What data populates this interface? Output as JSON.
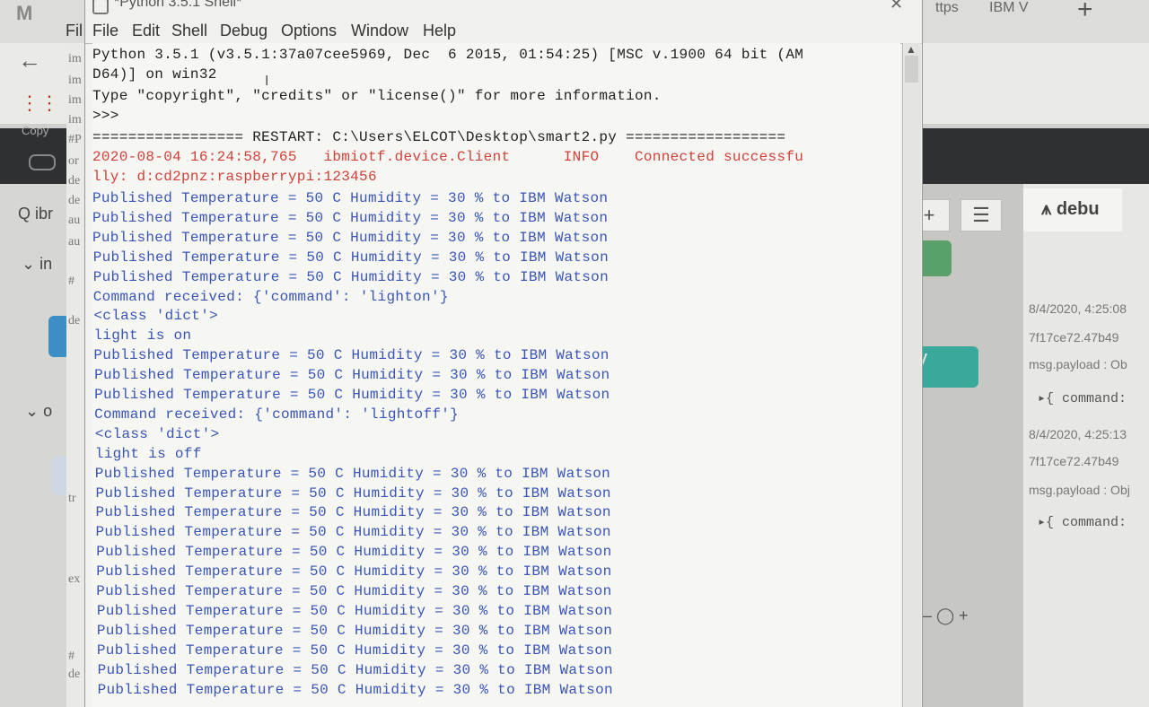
{
  "background": {
    "gmail_logo": "M",
    "tabs": [
      "ttps",
      "IBM V"
    ],
    "new_tab": "+",
    "back": "←",
    "dark_strip": "Copy",
    "left_search": "Q ibr",
    "left_in": "⌄ in",
    "left_o": "⌄ o",
    "node_teal_label": "y",
    "zoom_controls": "— ◯ +",
    "debug_title": "⩚ debu",
    "debug_messages": [
      {
        "time": "8/4/2020, 4:25:08",
        "node": "7f17ce72.47b49",
        "path": "msg.payload : Ob",
        "cmd": "▸{ command:"
      },
      {
        "time": "8/4/2020, 4:25:13",
        "node": "7f17ce72.47b49",
        "path": "msg.payload : Obj",
        "cmd": "▸{ command:"
      }
    ],
    "editor_strip": [
      "im",
      "im",
      "im",
      "im",
      "#P",
      "or",
      "de",
      "de",
      "au",
      "au",
      "#",
      "de",
      "tr",
      "ex",
      "#",
      "de"
    ]
  },
  "window": {
    "title": "*Python 3.5.1 Shell*",
    "close": "✕",
    "menu": [
      "File",
      "Edit",
      "Shell",
      "Debug",
      "Options",
      "Window",
      "Help"
    ],
    "menu_partial": "Fil"
  },
  "shell": {
    "header": [
      "Python 3.5.1 (v3.5.1:37a07cee5969, Dec  6 2015, 01:54:25) [MSC v.1900 64 bit (AM",
      "D64)] on win32",
      "Type \"copyright\", \"credits\" or \"license()\" for more information.",
      ">>> ",
      "================= RESTART: C:\\Users\\ELCOT\\Desktop\\smart2.py =================="
    ],
    "log_line1": "2020-08-04 16:24:58,765   ibmiotf.device.Client      INFO    Connected successfu",
    "log_line2": "lly: d:cd2pnz:raspberrypi:123456",
    "published": "Published Temperature = 50 C Humidity = 30 % to IBM Watson",
    "cmd_on": "Command received: {'command': 'lighton'}",
    "cmd_off": "Command received: {'command': 'lightoff'}",
    "class_dict": "<class 'dict'>",
    "light_on": "light is on",
    "light_off": "light is off"
  }
}
